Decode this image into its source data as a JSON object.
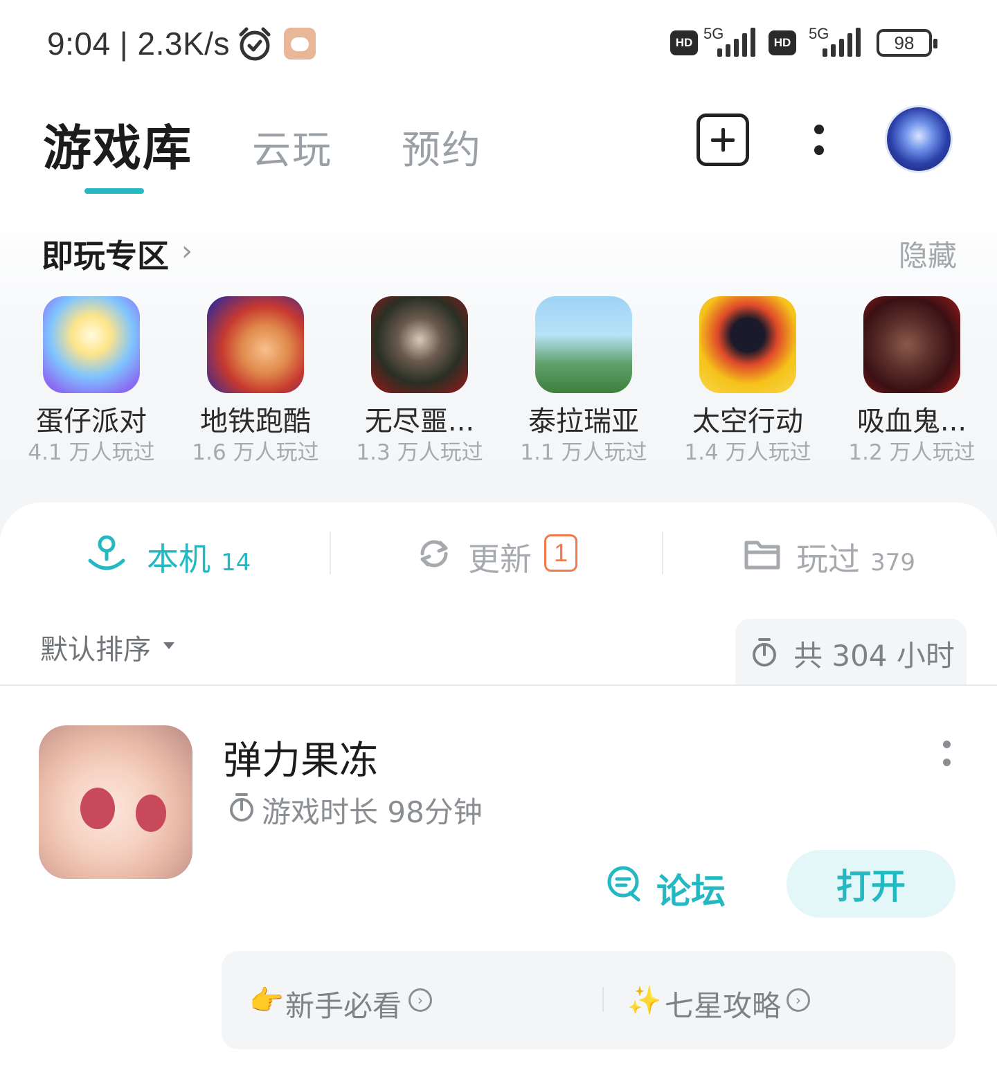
{
  "status_bar": {
    "time": "9:04 | 2.3K/s",
    "network_left": "5G",
    "network_right": "5G",
    "hd_label": "HD",
    "battery": "98"
  },
  "header": {
    "tabs": [
      {
        "label": "游戏库",
        "active": true
      },
      {
        "label": "云玩",
        "active": false
      },
      {
        "label": "预约",
        "active": false
      }
    ],
    "accent_color": "#23b8c2"
  },
  "instant_play": {
    "title": "即玩专区",
    "hide_label": "隐藏",
    "games": [
      {
        "name": "蛋仔派对",
        "plays": "4.1 万人玩过"
      },
      {
        "name": "地铁跑酷",
        "plays": "1.6 万人玩过"
      },
      {
        "name": "无尽噩...",
        "plays": "1.3 万人玩过"
      },
      {
        "name": "泰拉瑞亚",
        "plays": "1.1 万人玩过"
      },
      {
        "name": "太空行动",
        "plays": "1.4 万人玩过"
      },
      {
        "name": "吸血鬼...",
        "plays": "1.2 万人玩过"
      }
    ]
  },
  "segments": {
    "local": {
      "label": "本机",
      "count": "14"
    },
    "update": {
      "label": "更新",
      "badge": "1"
    },
    "played": {
      "label": "玩过",
      "count": "379"
    }
  },
  "list_header": {
    "sort_label": "默认排序",
    "total_time": "共 304 小时"
  },
  "game_item": {
    "title": "弹力果冻",
    "playtime": "游戏时长 98分钟",
    "forum_label": "论坛",
    "open_label": "打开",
    "tips": [
      {
        "emoji": "👉",
        "label": "新手必看"
      },
      {
        "emoji": "✨",
        "label": "七星攻略"
      }
    ]
  }
}
